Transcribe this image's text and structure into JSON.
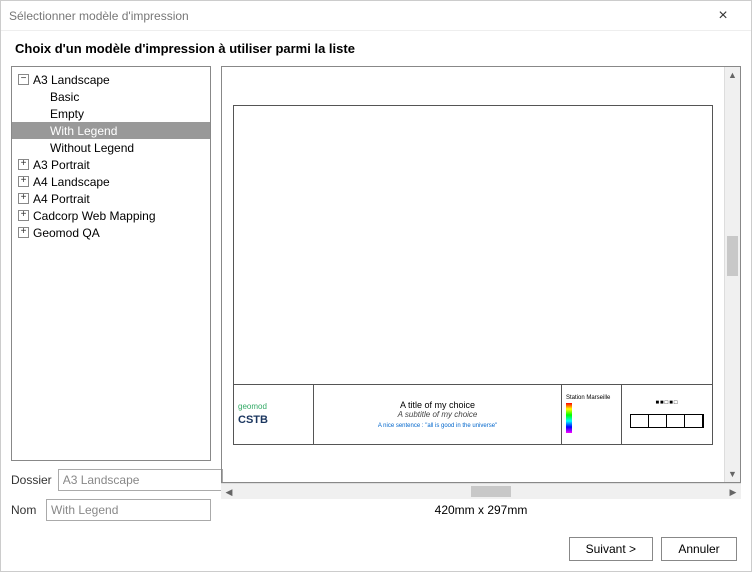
{
  "window": {
    "title": "Sélectionner modèle d'impression"
  },
  "instruction": "Choix d'un modèle d'impression à utiliser parmi la liste",
  "tree": {
    "root": {
      "label": "A3 Landscape",
      "children": [
        {
          "label": "Basic"
        },
        {
          "label": "Empty"
        },
        {
          "label": "With Legend",
          "selected": true
        },
        {
          "label": "Without Legend"
        }
      ]
    },
    "siblings": [
      {
        "label": "A3 Portrait"
      },
      {
        "label": "A4 Landscape"
      },
      {
        "label": "A4 Portrait"
      },
      {
        "label": "Cadcorp Web Mapping"
      },
      {
        "label": "Geomod QA"
      }
    ]
  },
  "fields": {
    "dossier_label": "Dossier",
    "dossier_value": "A3 Landscape",
    "nom_label": "Nom",
    "nom_value": "With Legend"
  },
  "preview": {
    "logo_top": "geomod",
    "logo_bottom": "CSTB",
    "title": "A title of my choice",
    "subtitle": "A subtitle of my choice",
    "caption": "A nice sentence : \"all is good in the universe\"",
    "legend_title": "Station Marseille",
    "scalebar_text": "■■□■□",
    "dimensions": "420mm x 297mm"
  },
  "buttons": {
    "next": "Suivant >",
    "cancel": "Annuler"
  }
}
